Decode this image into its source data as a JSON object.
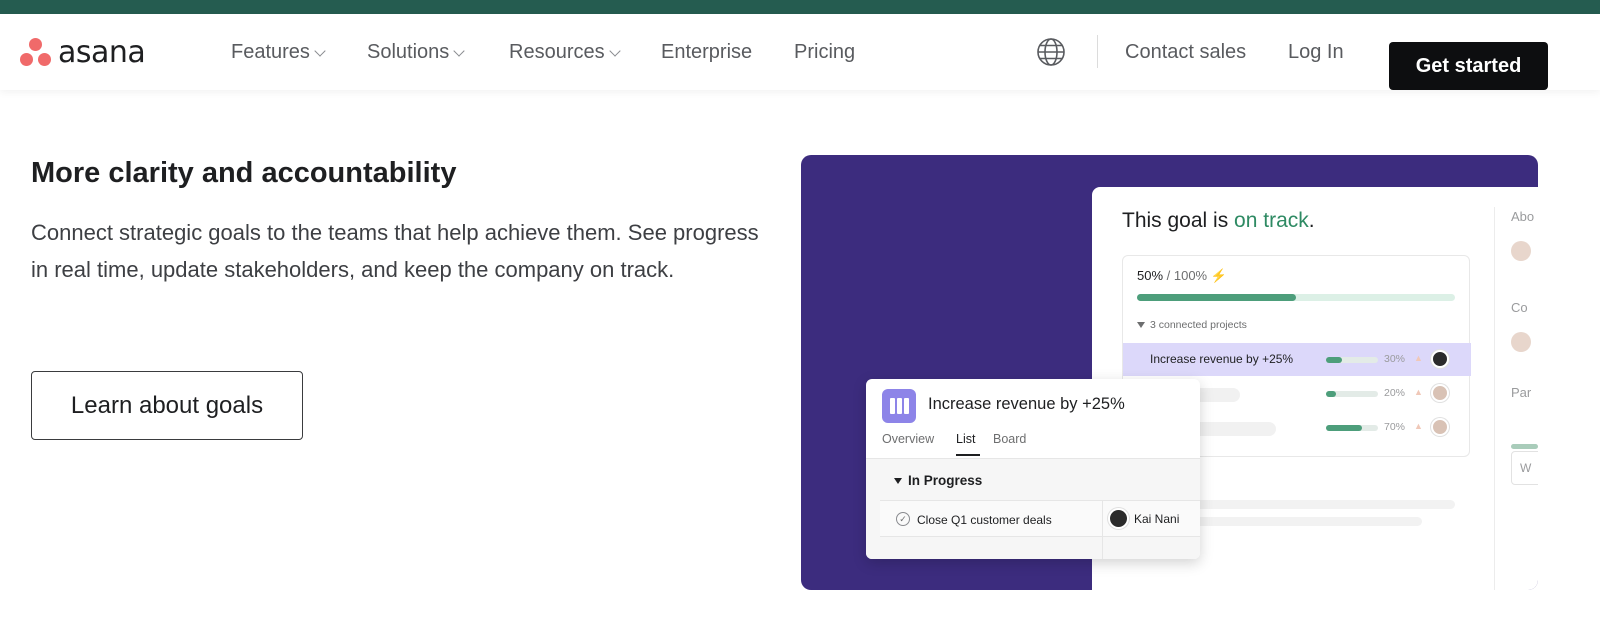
{
  "nav": {
    "logo_text": "asana",
    "items": [
      {
        "label": "Features",
        "dropdown": true
      },
      {
        "label": "Solutions",
        "dropdown": true
      },
      {
        "label": "Resources",
        "dropdown": true
      },
      {
        "label": "Enterprise",
        "dropdown": false
      },
      {
        "label": "Pricing",
        "dropdown": false
      }
    ],
    "globe_icon": "globe-icon",
    "contact_label": "Contact sales",
    "login_label": "Log In",
    "cta_label": "Get started"
  },
  "hero": {
    "headline": "More clarity and accountability",
    "description": "Connect strategic goals to the teams that help achieve them. See progress in real time, update stakeholders, and keep the company on track.",
    "button_label": "Learn about goals"
  },
  "goal_card": {
    "title_prefix": "This goal is ",
    "title_status": "on track",
    "title_suffix": ".",
    "progress_value": "50%",
    "progress_target": " / 100%",
    "progress_fraction": 0.5,
    "connected_label": "3 connected projects",
    "projects": [
      {
        "name": "Increase revenue by +25%",
        "percent": "30%",
        "fraction": 0.3
      },
      {
        "name": "",
        "percent": "20%",
        "fraction": 0.2
      },
      {
        "name": "",
        "percent": "70%",
        "fraction": 0.7
      }
    ],
    "side_labels": [
      "Abo",
      "Co",
      "Par"
    ],
    "side_box_text": "W"
  },
  "project_popup": {
    "title": "Increase revenue by +25%",
    "tabs": [
      "Overview",
      "List",
      "Board"
    ],
    "active_tab": "List",
    "section": "In Progress",
    "task": {
      "name": "Close Q1 customer deals",
      "assignee": "Kai Nani"
    }
  },
  "colors": {
    "top_bar": "#255c50",
    "panel": "#3c2c7e",
    "accent_green": "#2e8a63",
    "logo_coral": "#f06a6a",
    "highlight_row": "#dcd8fa",
    "project_icon": "#8d84e8"
  }
}
